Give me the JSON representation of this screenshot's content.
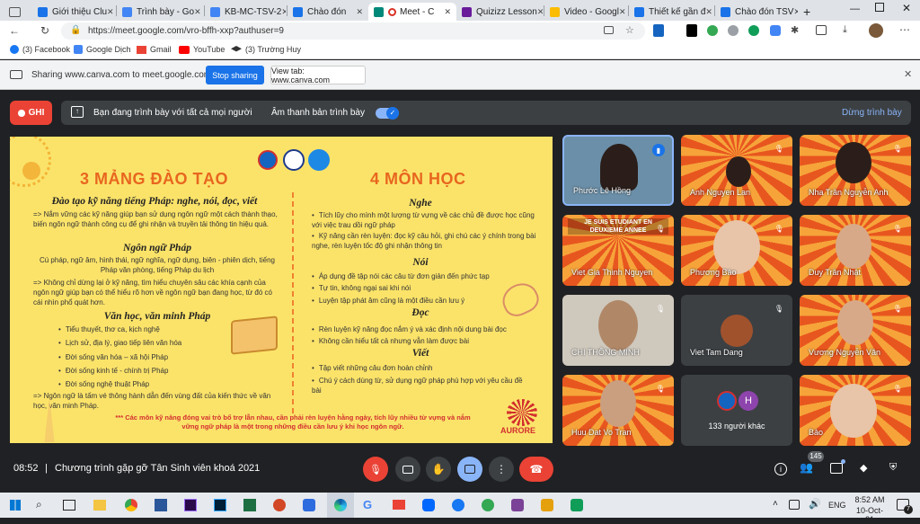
{
  "browser": {
    "tabs": [
      {
        "title": "Giới thiệu Clu",
        "color": "#1a73e8"
      },
      {
        "title": "Trình bày - Go",
        "color": "#4285f4"
      },
      {
        "title": "KB-MC-TSV-2",
        "color": "#4285f4"
      },
      {
        "title": "Chào đón",
        "color": "#1a73e8"
      },
      {
        "title": "Meet - C",
        "color": "#00897b"
      },
      {
        "title": "Quizizz Lesson",
        "color": "#6a1b9a"
      },
      {
        "title": "Video - Googl",
        "color": "#fbbc04"
      },
      {
        "title": "Thiết kế gần đ",
        "color": "#1a73e8"
      },
      {
        "title": "Chào đón TSV",
        "color": "#1a73e8"
      }
    ],
    "new_tab": "+",
    "url": "https://meet.google.com/vro-bffh-xxp?authuser=9",
    "bookmarks": [
      "(3) Facebook",
      "Google Dịch",
      "Gmail",
      "YouTube",
      "(3) Trường Huy"
    ]
  },
  "sharebar": {
    "message": "Sharing www.canva.com to meet.google.com",
    "stop": "Stop sharing",
    "view": "View tab: www.canva.com"
  },
  "meet": {
    "rec_label": "GHI",
    "presenting_text": "Bạn đang trình bày với tất cả mọi người",
    "audio_label": "Âm thanh bản trình bày",
    "stop_presenting": "Dừng trình bày",
    "time": "08:52",
    "meeting_title": "Chương trình gặp gỡ Tân Sinh viên khoá 2021",
    "people_count": "145",
    "others_label": "133 người khác",
    "others_avatar": "H",
    "participants": [
      "Phước Lê Hồng",
      "Anh Nguyen Lan",
      "Nha Trần Nguyễn Anh",
      "Viet Gia Thinh Nguyen",
      "Phương Bảo",
      "Duy Trần Nhật",
      "CHI THÔNG MINH",
      "Viet Tam Dang",
      "Vương Nguyễn Văn",
      "Huu Dat Vo Tran",
      "Bảo"
    ],
    "tile_banner": "JE SUIS ETUDIANT EN DEUXIEME ANNEE"
  },
  "slide": {
    "left_title": "3 MẢNG ĐÀO TẠO",
    "right_title": "4 MÔN HỌC",
    "s1_head": "Đào tạo kỹ năng tiếng Pháp: nghe, nói, đọc, viết",
    "s1_body": "=> Nắm vững các kỹ năng giúp bạn sử dụng ngôn ngữ một cách thành thạo, biến ngôn ngữ thành công cụ để ghi nhận và truyền tải thông tin hiệu quả.",
    "s2_head": "Ngôn ngữ Pháp",
    "s2_body": "Cú pháp, ngữ âm, hình thái, ngữ nghĩa, ngữ dụng, biên - phiên dịch, tiếng Pháp văn phòng, tiếng Pháp du lịch",
    "s2_note": "=> Không chỉ dừng lại ở kỹ năng, tìm hiểu chuyên sâu các khía cạnh của ngôn ngữ giúp bạn có thể hiểu rõ hơn về ngôn ngữ bạn đang học, từ đó có cái nhìn phổ quát hơn.",
    "s3_head": "Văn học, văn minh Pháp",
    "s3_items": [
      "Tiểu thuyết, thơ ca, kịch nghệ",
      "Lịch sử, địa lý, giao tiếp liên văn hóa",
      "Đời sống văn hóa – xã hội Pháp",
      "Đời sống kinh tế - chính trị Pháp",
      "Đời sống nghệ thuật Pháp"
    ],
    "s3_note": "=> Ngôn ngữ là tấm vé thông hành dẫn đến vùng đất của kiến thức về văn học, văn minh Pháp.",
    "nghe_head": "Nghe",
    "nghe_items": [
      "Tích lũy cho mình một lượng từ vựng về các chủ đề được học cũng với việc trau dồi ngữ pháp",
      "Kỹ năng cần rèn luyện: đọc kỹ câu hỏi, ghi chú các ý chính trong bài nghe, rèn luyện tốc độ ghi nhận thông tin"
    ],
    "noi_head": "Nói",
    "noi_items": [
      "Áp dụng đề tập nói các câu từ đơn giản đến phức tạp",
      "Tự tin, không ngại sai khi nói",
      "Luyện tập phát âm cũng là một điều cần lưu ý"
    ],
    "doc_head": "Đọc",
    "doc_items": [
      "Rèn luyện kỹ năng đọc nắm ý và xác định nội dung bài đọc",
      "Không cần hiểu tất cả nhưng vẫn làm được bài"
    ],
    "viet_head": "Viết",
    "viet_items": [
      "Tập viết những câu đơn hoàn chỉnh",
      "Chú ý cách dùng từ, sử dụng ngữ pháp phù hợp với yêu cầu đề bài"
    ],
    "footer": "*** Các môn kỹ năng đóng vai trò bổ trợ lẫn nhau, cần phải rèn luyện hằng ngày, tích lũy nhiều từ vựng và nắm vững ngữ pháp là một trong những điều cần lưu ý khi học ngôn ngữ.",
    "logo_text": "AURORE"
  },
  "taskbar": {
    "lang": "ENG",
    "time": "8:52 AM",
    "date": "10-Oct-21",
    "notif": "7"
  },
  "colors": {
    "slide_bg": "#fbe36a",
    "title_orange": "#e8661f",
    "red": "#ea4335",
    "blue": "#1a73e8"
  }
}
